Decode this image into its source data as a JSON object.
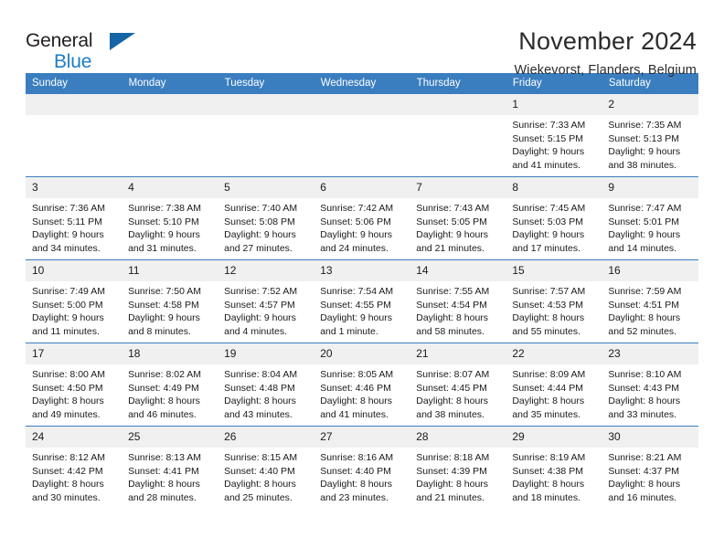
{
  "brand": {
    "name_part1": "General",
    "name_part2": "Blue",
    "flag_icon": "triangle-flag-icon",
    "accent_color": "#1d7cc4"
  },
  "header": {
    "month_title": "November 2024",
    "location": "Wiekevorst, Flanders, Belgium"
  },
  "calendar": {
    "header_color": "#3a7ebf",
    "weekday_headers": [
      "Sunday",
      "Monday",
      "Tuesday",
      "Wednesday",
      "Thursday",
      "Friday",
      "Saturday"
    ],
    "weeks": [
      [
        {
          "day": "",
          "empty": true
        },
        {
          "day": "",
          "empty": true
        },
        {
          "day": "",
          "empty": true
        },
        {
          "day": "",
          "empty": true
        },
        {
          "day": "",
          "empty": true
        },
        {
          "day": "1",
          "sunrise": "Sunrise: 7:33 AM",
          "sunset": "Sunset: 5:15 PM",
          "daylight": "Daylight: 9 hours and 41 minutes."
        },
        {
          "day": "2",
          "sunrise": "Sunrise: 7:35 AM",
          "sunset": "Sunset: 5:13 PM",
          "daylight": "Daylight: 9 hours and 38 minutes."
        }
      ],
      [
        {
          "day": "3",
          "sunrise": "Sunrise: 7:36 AM",
          "sunset": "Sunset: 5:11 PM",
          "daylight": "Daylight: 9 hours and 34 minutes."
        },
        {
          "day": "4",
          "sunrise": "Sunrise: 7:38 AM",
          "sunset": "Sunset: 5:10 PM",
          "daylight": "Daylight: 9 hours and 31 minutes."
        },
        {
          "day": "5",
          "sunrise": "Sunrise: 7:40 AM",
          "sunset": "Sunset: 5:08 PM",
          "daylight": "Daylight: 9 hours and 27 minutes."
        },
        {
          "day": "6",
          "sunrise": "Sunrise: 7:42 AM",
          "sunset": "Sunset: 5:06 PM",
          "daylight": "Daylight: 9 hours and 24 minutes."
        },
        {
          "day": "7",
          "sunrise": "Sunrise: 7:43 AM",
          "sunset": "Sunset: 5:05 PM",
          "daylight": "Daylight: 9 hours and 21 minutes."
        },
        {
          "day": "8",
          "sunrise": "Sunrise: 7:45 AM",
          "sunset": "Sunset: 5:03 PM",
          "daylight": "Daylight: 9 hours and 17 minutes."
        },
        {
          "day": "9",
          "sunrise": "Sunrise: 7:47 AM",
          "sunset": "Sunset: 5:01 PM",
          "daylight": "Daylight: 9 hours and 14 minutes."
        }
      ],
      [
        {
          "day": "10",
          "sunrise": "Sunrise: 7:49 AM",
          "sunset": "Sunset: 5:00 PM",
          "daylight": "Daylight: 9 hours and 11 minutes."
        },
        {
          "day": "11",
          "sunrise": "Sunrise: 7:50 AM",
          "sunset": "Sunset: 4:58 PM",
          "daylight": "Daylight: 9 hours and 8 minutes."
        },
        {
          "day": "12",
          "sunrise": "Sunrise: 7:52 AM",
          "sunset": "Sunset: 4:57 PM",
          "daylight": "Daylight: 9 hours and 4 minutes."
        },
        {
          "day": "13",
          "sunrise": "Sunrise: 7:54 AM",
          "sunset": "Sunset: 4:55 PM",
          "daylight": "Daylight: 9 hours and 1 minute."
        },
        {
          "day": "14",
          "sunrise": "Sunrise: 7:55 AM",
          "sunset": "Sunset: 4:54 PM",
          "daylight": "Daylight: 8 hours and 58 minutes."
        },
        {
          "day": "15",
          "sunrise": "Sunrise: 7:57 AM",
          "sunset": "Sunset: 4:53 PM",
          "daylight": "Daylight: 8 hours and 55 minutes."
        },
        {
          "day": "16",
          "sunrise": "Sunrise: 7:59 AM",
          "sunset": "Sunset: 4:51 PM",
          "daylight": "Daylight: 8 hours and 52 minutes."
        }
      ],
      [
        {
          "day": "17",
          "sunrise": "Sunrise: 8:00 AM",
          "sunset": "Sunset: 4:50 PM",
          "daylight": "Daylight: 8 hours and 49 minutes."
        },
        {
          "day": "18",
          "sunrise": "Sunrise: 8:02 AM",
          "sunset": "Sunset: 4:49 PM",
          "daylight": "Daylight: 8 hours and 46 minutes."
        },
        {
          "day": "19",
          "sunrise": "Sunrise: 8:04 AM",
          "sunset": "Sunset: 4:48 PM",
          "daylight": "Daylight: 8 hours and 43 minutes."
        },
        {
          "day": "20",
          "sunrise": "Sunrise: 8:05 AM",
          "sunset": "Sunset: 4:46 PM",
          "daylight": "Daylight: 8 hours and 41 minutes."
        },
        {
          "day": "21",
          "sunrise": "Sunrise: 8:07 AM",
          "sunset": "Sunset: 4:45 PM",
          "daylight": "Daylight: 8 hours and 38 minutes."
        },
        {
          "day": "22",
          "sunrise": "Sunrise: 8:09 AM",
          "sunset": "Sunset: 4:44 PM",
          "daylight": "Daylight: 8 hours and 35 minutes."
        },
        {
          "day": "23",
          "sunrise": "Sunrise: 8:10 AM",
          "sunset": "Sunset: 4:43 PM",
          "daylight": "Daylight: 8 hours and 33 minutes."
        }
      ],
      [
        {
          "day": "24",
          "sunrise": "Sunrise: 8:12 AM",
          "sunset": "Sunset: 4:42 PM",
          "daylight": "Daylight: 8 hours and 30 minutes."
        },
        {
          "day": "25",
          "sunrise": "Sunrise: 8:13 AM",
          "sunset": "Sunset: 4:41 PM",
          "daylight": "Daylight: 8 hours and 28 minutes."
        },
        {
          "day": "26",
          "sunrise": "Sunrise: 8:15 AM",
          "sunset": "Sunset: 4:40 PM",
          "daylight": "Daylight: 8 hours and 25 minutes."
        },
        {
          "day": "27",
          "sunrise": "Sunrise: 8:16 AM",
          "sunset": "Sunset: 4:40 PM",
          "daylight": "Daylight: 8 hours and 23 minutes."
        },
        {
          "day": "28",
          "sunrise": "Sunrise: 8:18 AM",
          "sunset": "Sunset: 4:39 PM",
          "daylight": "Daylight: 8 hours and 21 minutes."
        },
        {
          "day": "29",
          "sunrise": "Sunrise: 8:19 AM",
          "sunset": "Sunset: 4:38 PM",
          "daylight": "Daylight: 8 hours and 18 minutes."
        },
        {
          "day": "30",
          "sunrise": "Sunrise: 8:21 AM",
          "sunset": "Sunset: 4:37 PM",
          "daylight": "Daylight: 8 hours and 16 minutes."
        }
      ]
    ]
  }
}
